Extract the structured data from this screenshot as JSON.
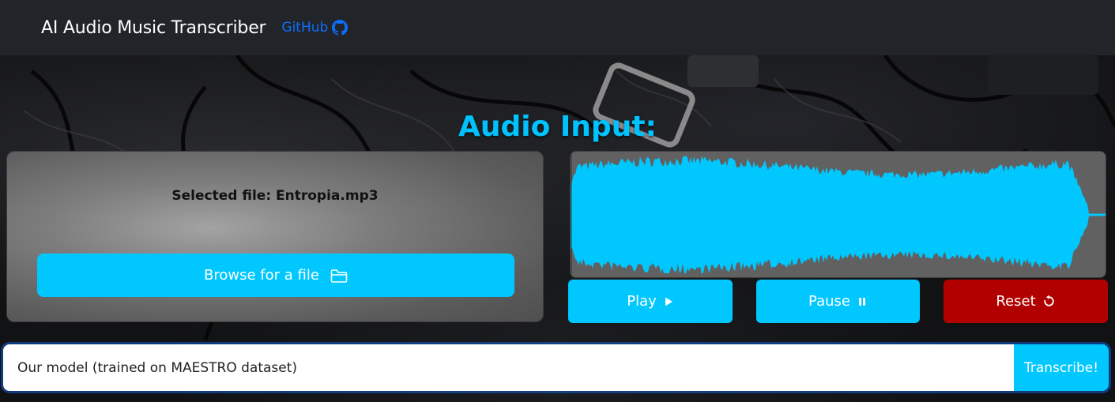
{
  "navbar": {
    "brand": "AI Audio Music Transcriber",
    "github_label": "GitHub",
    "github_icon": "github-icon"
  },
  "main": {
    "title": "Audio Input:",
    "file_card": {
      "selected_file_text": "Selected file: Entropia.mp3",
      "browse_label": "Browse for a file",
      "browse_icon": "folder-icon"
    },
    "player": {
      "play_label": "Play",
      "pause_label": "Pause",
      "reset_label": "Reset"
    },
    "model": {
      "input_value": "Our model (trained on MAESTRO dataset)",
      "transcribe_label": "Transcribe!"
    }
  },
  "colors": {
    "accent": "#00c8ff",
    "title": "#00c2ff",
    "github_link": "#0d6efd",
    "reset": "#b00000",
    "navbar": "#212529",
    "waveform": "#00c8ff",
    "waveform_bg": "#616161"
  }
}
